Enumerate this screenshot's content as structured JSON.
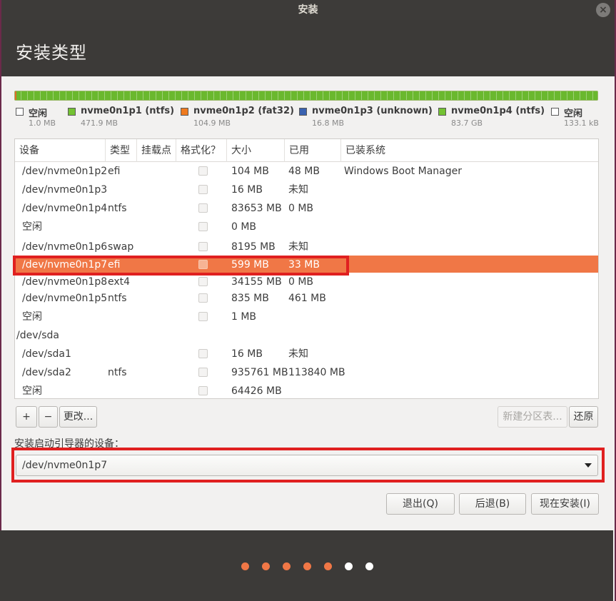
{
  "window": {
    "title": "安装",
    "close_glyph": "×"
  },
  "header": {
    "title": "安装类型"
  },
  "partition_bar": {
    "segments": [
      {
        "color": "#e06a2a",
        "fraction": 0.003
      },
      {
        "color": "#6ab82e",
        "fraction": 0.997
      }
    ]
  },
  "legend": [
    {
      "name": "空闲",
      "size": "1.0 MB",
      "color": "#ffffff"
    },
    {
      "name": "nvme0n1p1 (ntfs)",
      "size": "471.9 MB",
      "color": "#73c232"
    },
    {
      "name": "nvme0n1p2 (fat32)",
      "size": "104.9 MB",
      "color": "#ef7a1e"
    },
    {
      "name": "nvme0n1p3 (unknown)",
      "size": "16.8 MB",
      "color": "#3a62b0"
    },
    {
      "name": "nvme0n1p4 (ntfs)",
      "size": "83.7 GB",
      "color": "#73c232"
    },
    {
      "name": "空闲",
      "size": "133.1 kB",
      "color": "#ffffff"
    }
  ],
  "table": {
    "headers": [
      "设备",
      "类型",
      "挂载点",
      "格式化？",
      "大小",
      "已用",
      "已装系统"
    ],
    "rows": [
      {
        "device": "/dev/nvme0n1p2",
        "type": "efi",
        "mount": "",
        "format": true,
        "size": "104 MB",
        "used": "48 MB",
        "system": "Windows Boot Manager"
      },
      {
        "device": "/dev/nvme0n1p3",
        "type": "",
        "mount": "",
        "format": true,
        "size": "16 MB",
        "used": "未知",
        "system": ""
      },
      {
        "device": "/dev/nvme0n1p4",
        "type": "ntfs",
        "mount": "",
        "format": true,
        "size": "83653 MB",
        "used": "0 MB",
        "system": ""
      },
      {
        "device": "空闲",
        "type": "",
        "mount": "",
        "format": true,
        "size": "0 MB",
        "used": "",
        "system": ""
      },
      {
        "device": "/dev/nvme0n1p6",
        "type": "swap",
        "mount": "",
        "format": true,
        "size": "8195 MB",
        "used": "未知",
        "system": ""
      },
      {
        "device": "/dev/nvme0n1p7",
        "type": "efi",
        "mount": "",
        "format": true,
        "size": "599 MB",
        "used": "33 MB",
        "system": "",
        "selected": true
      },
      {
        "device": "/dev/nvme0n1p8",
        "type": "ext4",
        "mount": "",
        "format": true,
        "size": "34155 MB",
        "used": "0 MB",
        "system": ""
      },
      {
        "device": "/dev/nvme0n1p5",
        "type": "ntfs",
        "mount": "",
        "format": true,
        "size": "835 MB",
        "used": "461 MB",
        "system": ""
      },
      {
        "device": "空闲",
        "type": "",
        "mount": "",
        "format": true,
        "size": "1 MB",
        "used": "",
        "system": ""
      },
      {
        "device": "/dev/sda",
        "type": "",
        "mount": "",
        "format": false,
        "size": "",
        "used": "",
        "system": "",
        "disk": true
      },
      {
        "device": "/dev/sda1",
        "type": "",
        "mount": "",
        "format": true,
        "size": "16 MB",
        "used": "未知",
        "system": ""
      },
      {
        "device": "/dev/sda2",
        "type": "ntfs",
        "mount": "",
        "format": true,
        "size": "935761 MB",
        "used": "113840 MB",
        "system": ""
      },
      {
        "device": "空闲",
        "type": "",
        "mount": "",
        "format": true,
        "size": "64426 MB",
        "used": "",
        "system": ""
      }
    ]
  },
  "toolbar": {
    "add_label": "+",
    "remove_label": "−",
    "change_label": "更改...",
    "new_table_label": "新建分区表...",
    "revert_label": "还原"
  },
  "boot_loader": {
    "label": "安装启动引导器的设备：",
    "value": "/dev/nvme0n1p7"
  },
  "actions": {
    "quit_label": "退出(Q)",
    "back_label": "后退(B)",
    "install_label": "现在安装(I)"
  },
  "progress": {
    "total_steps": 7,
    "completed_steps": 5,
    "active_color": "#f07746",
    "inactive_color": "#ffffff"
  }
}
